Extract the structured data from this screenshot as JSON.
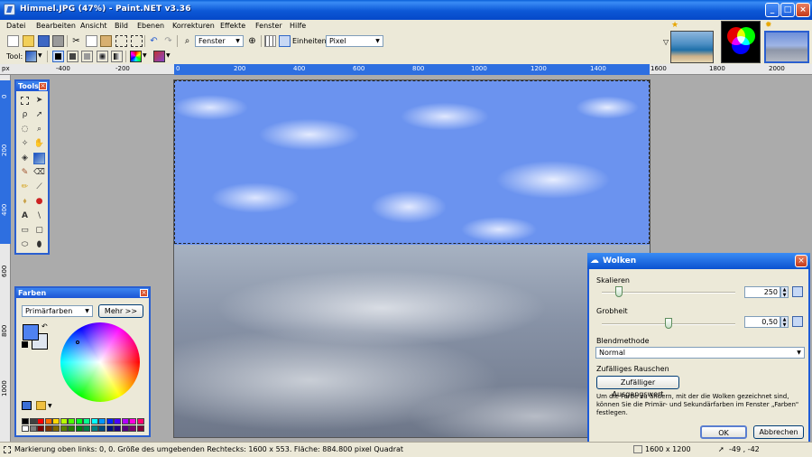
{
  "window": {
    "title": "Himmel.JPG (47%) - Paint.NET v3.36"
  },
  "menu": [
    "Datei",
    "Bearbeiten",
    "Ansicht",
    "Bild",
    "Ebenen",
    "Korrekturen",
    "Effekte",
    "Fenster",
    "Hilfe"
  ],
  "toolbar": {
    "zoom_value": "Fenster",
    "units_label": "Einheiten:",
    "units_value": "Pixel",
    "tool_label": "Tool:"
  },
  "ruler": {
    "unit": "px",
    "h_ticks": [
      "-400",
      "-200",
      "0",
      "200",
      "400",
      "600",
      "800",
      "1000",
      "1200",
      "1400",
      "1600",
      "1800",
      "2000"
    ],
    "v_ticks": [
      "0",
      "200",
      "400",
      "600",
      "800",
      "1000"
    ]
  },
  "tools_window": {
    "title": "Tools"
  },
  "colors_window": {
    "title": "Farben",
    "mode_value": "Primärfarben",
    "more_button": "Mehr >>",
    "palette": [
      "#000000",
      "#404040",
      "#ff0000",
      "#ff6a00",
      "#ffd800",
      "#b6ff00",
      "#4cff00",
      "#00ff21",
      "#00ff90",
      "#00ffff",
      "#0094ff",
      "#0026ff",
      "#4800ff",
      "#b200ff",
      "#ff00dc",
      "#ff006e",
      "#ffffff",
      "#808080",
      "#7f0000",
      "#7f3300",
      "#7f6a00",
      "#5b7f00",
      "#267f00",
      "#007f0e",
      "#007f46",
      "#007f7f",
      "#004a7f",
      "#00137f",
      "#21007f",
      "#57007f",
      "#7f006e",
      "#7f0037"
    ]
  },
  "dialog": {
    "title": "Wolken",
    "scale_label": "Skalieren",
    "scale_value": "250",
    "scale_level": 0.25,
    "roughness_label": "Grobheit",
    "roughness_value": "0,50",
    "roughness_level": 0.5,
    "blend_label": "Blendmethode",
    "blend_value": "Normal",
    "noise_label": "Zufälliges Rauschen",
    "random_button": "Zufälliger Ausgangswert",
    "help_text": "Um die Farbe zu ändern, mit der die Wolken gezeichnet sind, können Sie die Primär- und Sekundärfarben im Fenster „Farben\" festlegen.",
    "ok_button": "OK",
    "cancel_button": "Abbrechen"
  },
  "status": {
    "text": "Markierung oben links: 0, 0. Größe des umgebenden Rechtecks: 1600 x 553. Fläche: 884.800 pixel Quadrat",
    "image_size": "1600 x 1200",
    "coords": "-49 , -42"
  }
}
